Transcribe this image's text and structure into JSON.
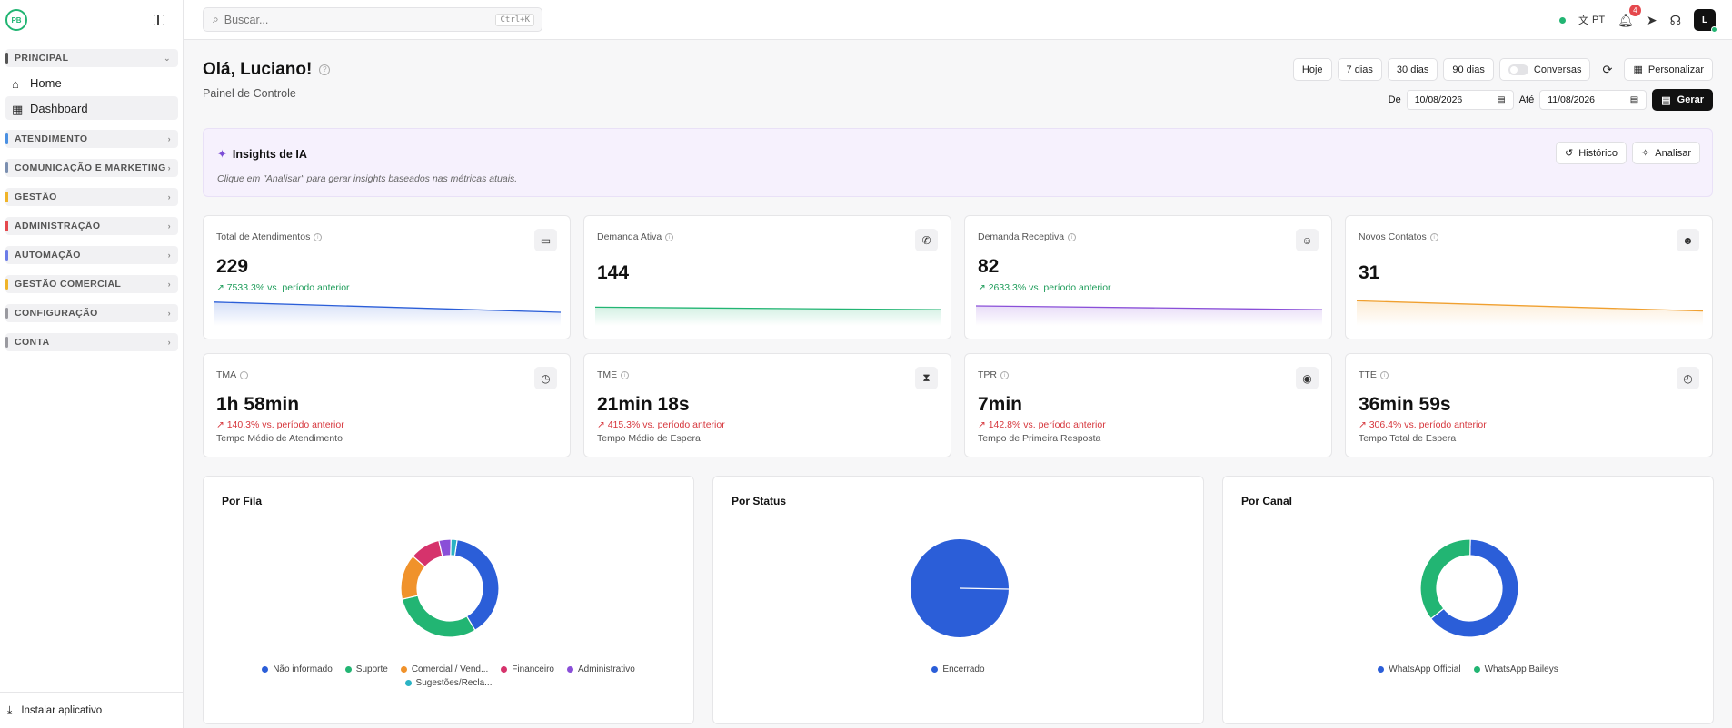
{
  "sidebar": {
    "sections": [
      {
        "label": "PRINCIPAL",
        "color": "#555555",
        "expanded": true
      },
      {
        "label": "ATENDIMENTO",
        "color": "#4a90e2"
      },
      {
        "label": "COMUNICAÇÃO E MARKETING",
        "color": "#7b8fb0"
      },
      {
        "label": "GESTÃO",
        "color": "#f0b429"
      },
      {
        "label": "ADMINISTRAÇÃO",
        "color": "#e5484d"
      },
      {
        "label": "AUTOMAÇÃO",
        "color": "#6b7ce8"
      },
      {
        "label": "GESTÃO COMERCIAL",
        "color": "#f0b429"
      },
      {
        "label": "CONFIGURAÇÃO",
        "color": "#9a9aa0"
      },
      {
        "label": "CONTA",
        "color": "#9a9aa0"
      }
    ],
    "items": [
      {
        "label": "Home",
        "icon": "home-icon"
      },
      {
        "label": "Dashboard",
        "icon": "grid-icon",
        "active": true
      }
    ],
    "install_label": "Instalar aplicativo"
  },
  "header": {
    "search_placeholder": "Buscar...",
    "search_shortcut": "Ctrl+K",
    "language": "PT",
    "notification_count": "4",
    "avatar_initial": "L"
  },
  "page": {
    "greeting": "Olá, Luciano!",
    "subtitle": "Painel de Controle",
    "range_buttons": [
      "Hoje",
      "7 dias",
      "30 dias",
      "90 dias"
    ],
    "conversas_label": "Conversas",
    "personalizar_label": "Personalizar",
    "from_label": "De",
    "from_date": "10/08/2026",
    "to_label": "Até",
    "to_date": "11/08/2026",
    "gerar_label": "Gerar"
  },
  "insights": {
    "title": "Insights de IA",
    "description": "Clique em \"Analisar\" para gerar insights baseados nas métricas atuais.",
    "historico_label": "Histórico",
    "analisar_label": "Analisar"
  },
  "kpis_top": [
    {
      "label": "Total de Atendimentos",
      "value": "229",
      "delta": "7533.3% vs. período anterior",
      "trend": "green",
      "icon": "chat-icon",
      "line_color": "#2b5ed8",
      "spark": [
        8,
        0
      ]
    },
    {
      "label": "Demanda Ativa",
      "value": "144",
      "delta": "",
      "trend": "none",
      "icon": "phone-icon",
      "line_color": "#22b573",
      "spark": [
        4,
        2
      ]
    },
    {
      "label": "Demanda Receptiva",
      "value": "82",
      "delta": "2633.3% vs. período anterior",
      "trend": "green",
      "icon": "user-check-icon",
      "line_color": "#8a4fd8",
      "spark": [
        5,
        2
      ]
    },
    {
      "label": "Novos Contatos",
      "value": "31",
      "delta": "",
      "trend": "none",
      "icon": "users-icon",
      "line_color": "#f0a030",
      "spark": [
        9,
        1
      ]
    }
  ],
  "kpis_bottom": [
    {
      "label": "TMA",
      "value": "1h 58min",
      "delta": "140.3% vs. período anterior",
      "sub": "Tempo Médio de Atendimento",
      "icon": "clock-icon"
    },
    {
      "label": "TME",
      "value": "21min 18s",
      "delta": "415.3% vs. período anterior",
      "sub": "Tempo Médio de Espera",
      "icon": "hourglass-icon"
    },
    {
      "label": "TPR",
      "value": "7min",
      "delta": "142.8% vs. período anterior",
      "sub": "Tempo de Primeira Resposta",
      "icon": "message-reply-icon"
    },
    {
      "label": "TTE",
      "value": "36min 59s",
      "delta": "306.4% vs. período anterior",
      "sub": "Tempo Total de Espera",
      "icon": "timer-icon"
    }
  ],
  "chart_data": [
    {
      "type": "pie",
      "title": "Por Fila",
      "donut": true,
      "categories": [
        "Não informado",
        "Suporte",
        "Comercial / Vend...",
        "Financeiro",
        "Administrativo",
        "Sugestões/Recla..."
      ],
      "values": [
        39,
        30,
        15,
        10,
        4,
        2
      ],
      "colors": [
        "#2b5ed8",
        "#22b573",
        "#f0922b",
        "#d6336c",
        "#8a4fd8",
        "#2bb3c4"
      ],
      "legend": "bottom"
    },
    {
      "type": "pie",
      "title": "Por Status",
      "donut": false,
      "categories": [
        "Encerrado"
      ],
      "values": [
        100
      ],
      "colors": [
        "#2b5ed8"
      ],
      "legend": "bottom"
    },
    {
      "type": "pie",
      "title": "Por Canal",
      "donut": true,
      "categories": [
        "WhatsApp Official",
        "WhatsApp Baileys"
      ],
      "values": [
        64,
        36
      ],
      "colors": [
        "#2b5ed8",
        "#22b573"
      ],
      "legend": "bottom"
    }
  ]
}
